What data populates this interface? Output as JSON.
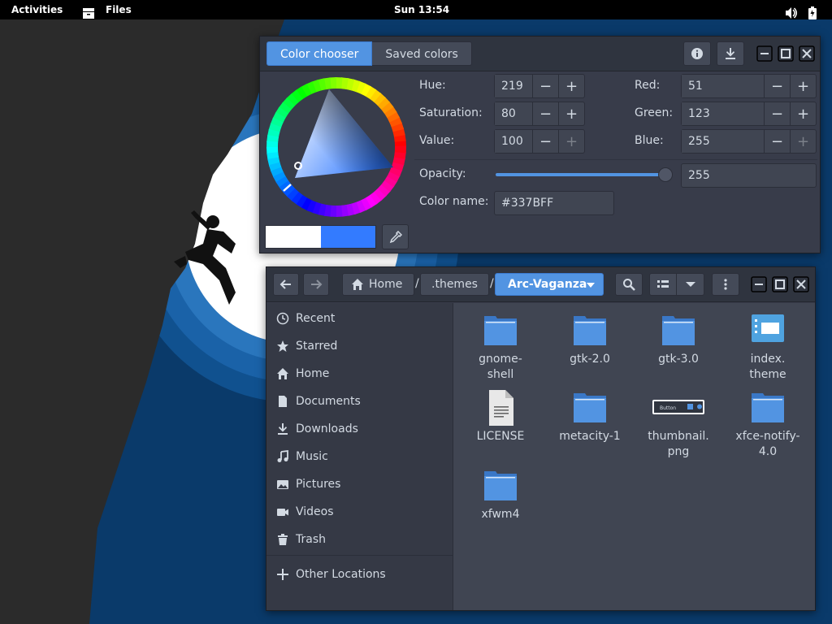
{
  "topbar": {
    "activities": "Activities",
    "app_name": "Files",
    "clock": "Sun 13:54"
  },
  "color_chooser": {
    "tabs": [
      {
        "label": "Color chooser",
        "active": true
      },
      {
        "label": "Saved colors",
        "active": false
      }
    ],
    "hue": {
      "label": "Hue:",
      "value": "219"
    },
    "saturation": {
      "label": "Saturation:",
      "value": "80"
    },
    "value": {
      "label": "Value:",
      "value": "100"
    },
    "red": {
      "label": "Red:",
      "value": "51"
    },
    "green": {
      "label": "Green:",
      "value": "123"
    },
    "blue": {
      "label": "Blue:",
      "value": "255"
    },
    "opacity": {
      "label": "Opacity:",
      "value": "255",
      "level": 1.0
    },
    "color_name": {
      "label": "Color name:",
      "value": "#337BFF"
    },
    "current_color": "#337bff",
    "previous_color": "#ffffff",
    "accent": "#5294e2"
  },
  "files": {
    "breadcrumbs": [
      {
        "label": "Home",
        "icon": "home-icon"
      },
      {
        "label": ".themes"
      },
      {
        "label": "Arc-Vaganza",
        "active": true
      }
    ],
    "sidebar": [
      {
        "label": "Recent",
        "icon": "clock-icon"
      },
      {
        "label": "Starred",
        "icon": "star-icon"
      },
      {
        "label": "Home",
        "icon": "home-icon"
      },
      {
        "label": "Documents",
        "icon": "document-icon"
      },
      {
        "label": "Downloads",
        "icon": "download-icon"
      },
      {
        "label": "Music",
        "icon": "music-icon"
      },
      {
        "label": "Pictures",
        "icon": "picture-icon"
      },
      {
        "label": "Videos",
        "icon": "video-icon"
      },
      {
        "label": "Trash",
        "icon": "trash-icon"
      },
      {
        "label": "Other Locations",
        "icon": "plus-icon"
      }
    ],
    "items": [
      {
        "name_line1": "gnome-",
        "name_line2": "shell",
        "type": "folder"
      },
      {
        "name_line1": "gtk-2.0",
        "name_line2": "",
        "type": "folder"
      },
      {
        "name_line1": "gtk-3.0",
        "name_line2": "",
        "type": "folder"
      },
      {
        "name_line1": "index.",
        "name_line2": "theme",
        "type": "theme"
      },
      {
        "name_line1": "LICENSE",
        "name_line2": "",
        "type": "text"
      },
      {
        "name_line1": "metacity-1",
        "name_line2": "",
        "type": "folder"
      },
      {
        "name_line1": "thumbnail.",
        "name_line2": "png",
        "type": "image"
      },
      {
        "name_line1": "xfce-notify-",
        "name_line2": "4.0",
        "type": "folder"
      },
      {
        "name_line1": "xfwm4",
        "name_line2": "",
        "type": "folder"
      }
    ],
    "thumbnail_text": "Button"
  }
}
